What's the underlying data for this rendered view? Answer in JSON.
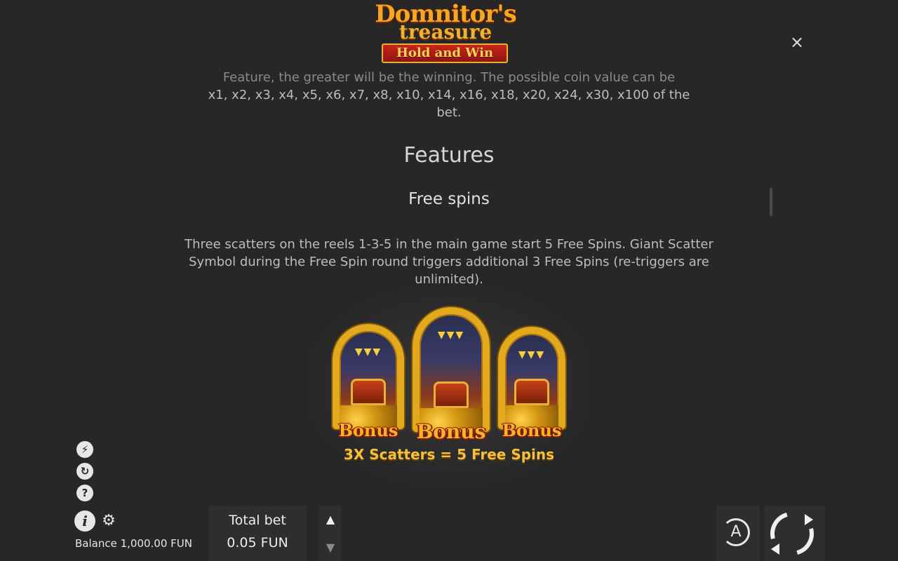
{
  "logo": {
    "line1": "Domnitor's",
    "line2": "treasure",
    "line3": "Hold and Win"
  },
  "close_label": "×",
  "intro": {
    "line1": "Feature, the greater will be the winning. The possible coin value can be",
    "line2": "x1, x2, x3, x4, x5, x6, x7, x8, x10, x14, x16, x18, x20, x24, x30, x100 of the",
    "line3": "bet."
  },
  "features_heading": "Features",
  "free_spins": {
    "heading": "Free spins",
    "line1": "Three scatters on the reels 1-3-5 in the main game start 5 Free Spins. Giant Scatter",
    "line2": "Symbol during the Free Spin round triggers additional 3 Free Spins (re-triggers are",
    "line3": "unlimited)."
  },
  "illustration": {
    "bonus_labels": [
      "Bonus",
      "Bonus",
      "Bonus"
    ],
    "caption": "3X Scatters = 5 Free Spins"
  },
  "side_icons": [
    {
      "name": "turbo-icon",
      "glyph": "⚡"
    },
    {
      "name": "quick-spin-icon",
      "glyph": "↻"
    },
    {
      "name": "help-icon",
      "glyph": "?"
    }
  ],
  "info_glyph": "i",
  "gear_glyph": "⚙",
  "balance": {
    "text": "Balance 1,000.00 FUN"
  },
  "bet": {
    "label": "Total bet",
    "value": "0.05 FUN",
    "up_glyph": "▲",
    "down_glyph": "▼"
  },
  "auto_letter": "A",
  "colors": {
    "background": "#272727",
    "accent_gold": "#f2c040",
    "panel": "#2e2e2e"
  }
}
